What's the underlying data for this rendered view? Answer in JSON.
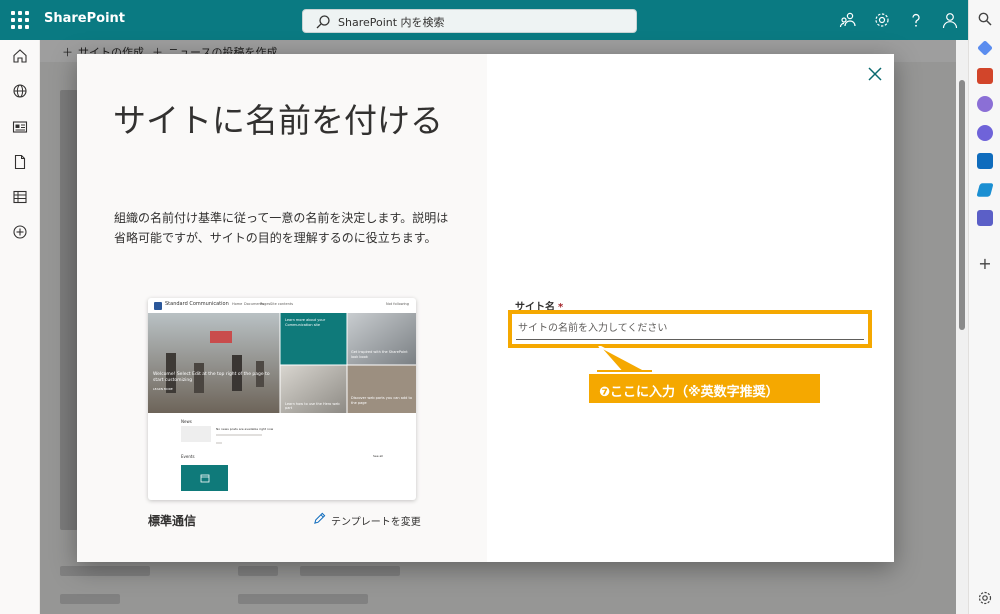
{
  "suite_bar": {
    "brand": "SharePoint",
    "search_placeholder": "SharePoint 内を検索"
  },
  "command_bar": {
    "create_site": "サイトの作成",
    "create_news": "ニュースの投稿を作成"
  },
  "modal": {
    "title": "サイトに名前を付ける",
    "description": "組織の名前付け基準に従って一意の名前を決定します。説明は省略可能ですが、サイトの目的を理解するのに役立ちます。",
    "template_name": "標準通信",
    "change_template": "テンプレートを変更",
    "field_label": "サイト名",
    "required_mark": "*",
    "field_placeholder": "サイトの名前を入力してください",
    "field_value": ""
  },
  "preview": {
    "site_name": "Standard Communication",
    "nav": [
      "Home",
      "Documents",
      "Pages",
      "Site contents"
    ],
    "follow": "Not following",
    "hero_main": "Welcome! Select Edit at the top right of the page to start customizing",
    "hero_tile_1": "Learn more about your Communication site",
    "hero_tile_2": "Get inspired with the SharePoint look book",
    "hero_tile_3": "Learn how to use the Hero web part",
    "hero_tile_4": "Discover web parts you can add to the page",
    "learn_more": "LEARN MORE",
    "news_heading": "News",
    "news_text": "No news posts are available right now",
    "events_heading": "Events",
    "see_all": "See all"
  },
  "annotation": {
    "callout": "❼ここに入力（※英数字推奨）",
    "highlight_color": "#f5a800"
  },
  "colors": {
    "suite_bar": "#0a7a82",
    "accent": "#0f7a7a"
  }
}
